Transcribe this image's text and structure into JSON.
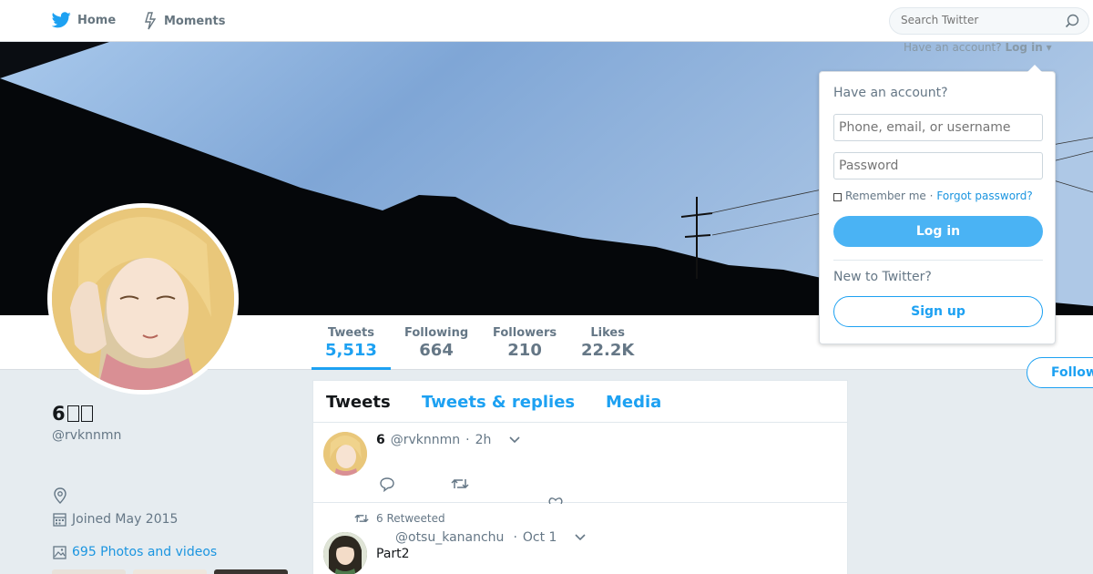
{
  "nav": {
    "home_label": "Home",
    "moments_label": "Moments",
    "search_placeholder": "Search Twitter"
  },
  "account_bar": {
    "prompt": "Have an account?",
    "login": "Log in"
  },
  "login_dropdown": {
    "title": "Have an account?",
    "username_placeholder": "Phone, email, or username",
    "password_placeholder": "Password",
    "remember_label": "Remember me ·",
    "forgot_label": "Forgot password?",
    "login_button": "Log in",
    "new_prompt": "New to Twitter?",
    "signup_button": "Sign up"
  },
  "profile": {
    "display_name": "6",
    "handle": "@rvknnmn",
    "joined": "Joined May 2015",
    "photos_link": "695 Photos and videos",
    "follow_button": "Follow"
  },
  "stats": [
    {
      "label": "Tweets",
      "value": "5,513"
    },
    {
      "label": "Following",
      "value": "664"
    },
    {
      "label": "Followers",
      "value": "210"
    },
    {
      "label": "Likes",
      "value": "22.2K"
    }
  ],
  "timeline_tabs": [
    "Tweets",
    "Tweets & replies",
    "Media"
  ],
  "tweets": [
    {
      "name": "6",
      "handle": "@rvknnmn",
      "time": "2h"
    },
    {
      "retweet_context": "6 Retweeted",
      "name": "",
      "handle": "@otsu_kananchu",
      "time": "Oct 1",
      "text": "Part2"
    }
  ],
  "colors": {
    "accent": "#1da1f2",
    "background": "#e6ecf0"
  }
}
